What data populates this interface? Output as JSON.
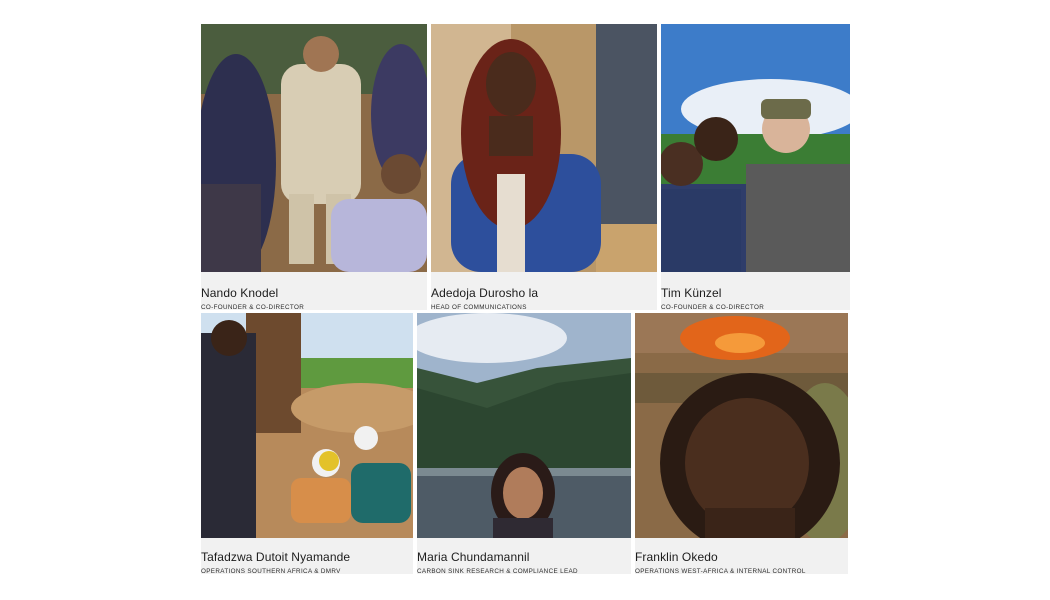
{
  "team": {
    "members": [
      {
        "name": "Nando Knodel",
        "role": "CO-FOUNDER & CO-DIRECTOR",
        "photo_icon": "group-photo-icon",
        "photo_colors": [
          "#8b6a47",
          "#d8cdb4",
          "#3c3a62"
        ]
      },
      {
        "name": "Adedoja Durosho la",
        "role": "HEAD OF COMMUNICATIONS",
        "photo_icon": "portrait-photo-icon",
        "photo_colors": [
          "#b99768",
          "#2d4f9c",
          "#6a2318"
        ]
      },
      {
        "name": "Tim Künzel",
        "role": "CO-FOUNDER & CO-DIRECTOR",
        "photo_icon": "group-photo-icon",
        "photo_colors": [
          "#3d7cc9",
          "#3b7d34",
          "#2f3d6a"
        ]
      },
      {
        "name": "Tafadzwa Dutoit Nyamande",
        "role": "OPERATIONS SOUTHERN AFRICA & DMRV",
        "photo_icon": "field-photo-icon",
        "photo_colors": [
          "#cfe0ef",
          "#b78a5b",
          "#2a2a36"
        ]
      },
      {
        "name": "Maria Chundamannil",
        "role": "CARBON SINK RESEARCH & COMPLIANCE LEAD",
        "photo_icon": "landscape-selfie-icon",
        "photo_colors": [
          "#9fb4cc",
          "#37533a",
          "#4e5b66"
        ]
      },
      {
        "name": "Franklin Okedo",
        "role": "OPERATIONS WEST-AFRICA & INTERNAL CONTROL",
        "photo_icon": "selfie-photo-icon",
        "photo_colors": [
          "#8a6a47",
          "#e2651a",
          "#2a1b13"
        ]
      }
    ]
  }
}
